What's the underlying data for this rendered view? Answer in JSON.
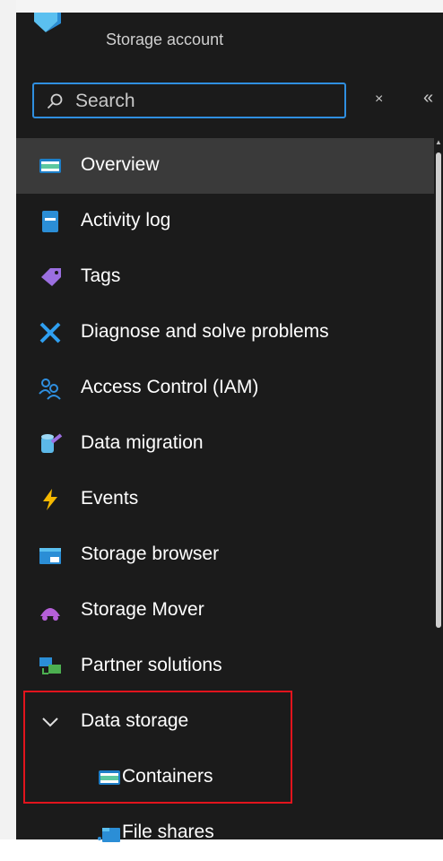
{
  "header": {
    "subtitle": "Storage account"
  },
  "search": {
    "placeholder": "Search"
  },
  "controls": {
    "clear_icon": "×",
    "collapse_icon": "«"
  },
  "nav": {
    "items": [
      {
        "label": "Overview",
        "icon": "overview-icon",
        "active": true
      },
      {
        "label": "Activity log",
        "icon": "activity-log-icon"
      },
      {
        "label": "Tags",
        "icon": "tag-icon"
      },
      {
        "label": "Diagnose and solve problems",
        "icon": "wrench-icon"
      },
      {
        "label": "Access Control (IAM)",
        "icon": "people-icon"
      },
      {
        "label": "Data migration",
        "icon": "data-migration-icon"
      },
      {
        "label": "Events",
        "icon": "lightning-icon"
      },
      {
        "label": "Storage browser",
        "icon": "storage-browser-icon"
      },
      {
        "label": "Storage Mover",
        "icon": "storage-mover-icon"
      },
      {
        "label": "Partner solutions",
        "icon": "partner-solutions-icon"
      }
    ],
    "section": {
      "label": "Data storage",
      "expanded": true
    },
    "section_items": [
      {
        "label": "Containers",
        "icon": "containers-icon"
      },
      {
        "label": "File shares",
        "icon": "file-shares-icon"
      }
    ]
  },
  "colors": {
    "background": "#1b1b1b",
    "active_row": "#3a3a3a",
    "search_border": "#2f8fe0",
    "highlight_box": "#e2141d"
  }
}
